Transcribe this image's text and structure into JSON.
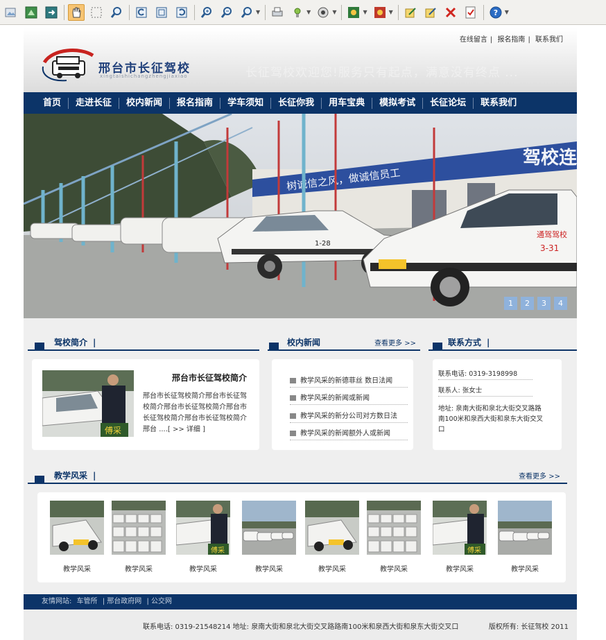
{
  "toolbar": {
    "icons": [
      "open-icon",
      "save-image-icon",
      "export-icon",
      "hand-tool-icon",
      "select-icon",
      "find-icon",
      "rotate-left-icon",
      "fit-page-icon",
      "rotate-right-icon",
      "zoom-in-icon",
      "zoom-out-icon",
      "zoom-menu-icon",
      "print-icon",
      "tools-icon",
      "effects-icon",
      "color-icon",
      "color2-icon",
      "edit-icon",
      "edit2-icon",
      "delete-icon",
      "checkmark-icon",
      "help-icon"
    ]
  },
  "header": {
    "top_links": [
      "在线留言",
      "报名指南",
      "联系我们"
    ],
    "school_name": "邢台市长征驾校",
    "school_pinyin": "xingtaishichangzhengjiaxiao",
    "slogan": "长征驾校欢迎您!服务只有起点，满意没有终点 ..."
  },
  "nav": [
    "首页",
    "走进长征",
    "校内新闻",
    "报名指南",
    "学车须知",
    "长征你我",
    "用车宝典",
    "模拟考试",
    "长征论坛",
    "联系我们"
  ],
  "banner": {
    "slide_numbers": [
      "1",
      "2",
      "3",
      "4"
    ],
    "sign_text": "驾校连续",
    "sign_text2": "树诚信之风，做诚信员工",
    "car_labels": [
      "1-28",
      "3-31"
    ],
    "car_door_text": "通驾驾校"
  },
  "intro": {
    "heading": "驾校简介",
    "title": "邢台市长征驾校简介",
    "body": "邢台市长征驾校简介邢台市长征驾校简介邢台市长征驾校简介邢台市长征驾校简介邢台市长征驾校简介邢台",
    "more": "....[ >> 详细 ]"
  },
  "news": {
    "heading": "校内新闻",
    "more": "查看更多 >>",
    "items": [
      "教学风采的新德菲丝 数日法闻",
      "教学风采的新闻或新闻",
      "教学风采的新分公司对方数日法",
      "教学风采的新闻额外人或新闻"
    ]
  },
  "contact": {
    "heading": "联系方式",
    "phone": "联系电话: 0319-3198998",
    "person": "联系人: 张女士",
    "address": "地址: 泉南大街和泉北大街交叉路路南100米和泉西大街和泉东大街交叉口"
  },
  "gallery": {
    "heading": "教学风采",
    "more": "查看更多 >>",
    "captions": [
      "教学风采",
      "教学风采",
      "教学风采",
      "教学风采",
      "教学风采",
      "教学风采",
      "教学风采",
      "教学风采"
    ]
  },
  "footer": {
    "links_label": "友情网站:",
    "links": [
      "车管所",
      "邢台政府网",
      "公交网"
    ],
    "contact": "联系电话: 0319-21548214   地址: 泉南大街和泉北大街交叉路路南100米和泉西大街和泉东大街交叉口",
    "copyright": "版权所有: 长征驾校 2011"
  },
  "colors": {
    "nav_bg": "#0c3468",
    "accent": "#0c3468"
  }
}
